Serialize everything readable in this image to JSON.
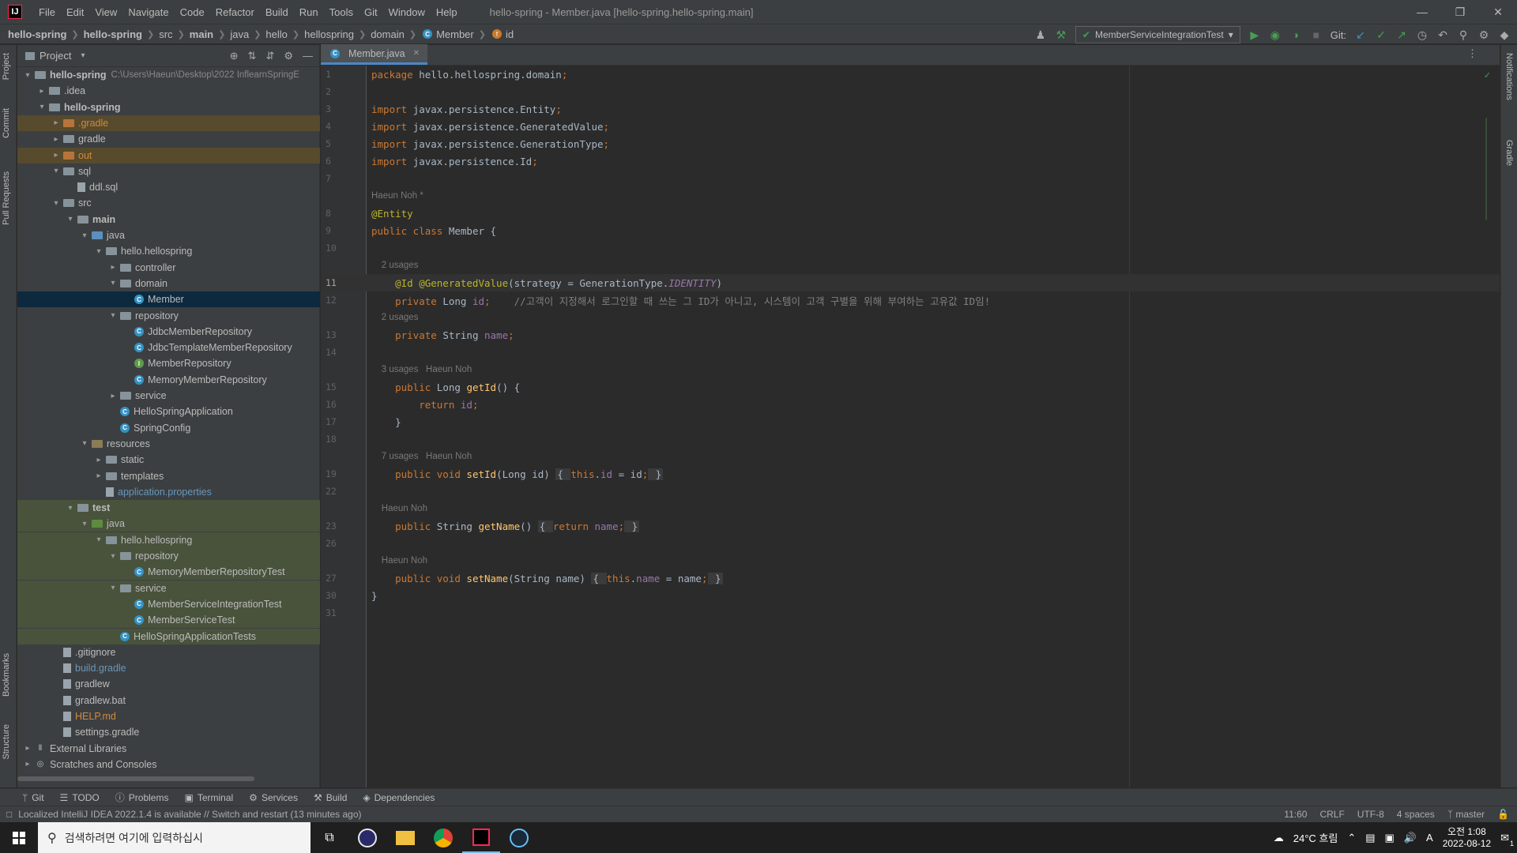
{
  "titlebar": {
    "menu": [
      "File",
      "Edit",
      "View",
      "Navigate",
      "Code",
      "Refactor",
      "Build",
      "Run",
      "Tools",
      "Git",
      "Window",
      "Help"
    ],
    "window_title": "hello-spring - Member.java [hello-spring.hello-spring.main]"
  },
  "navbar": {
    "crumbs": [
      "hello-spring",
      "hello-spring",
      "src",
      "main",
      "java",
      "hello",
      "hellospring",
      "domain",
      "Member",
      "id"
    ],
    "run_config": "MemberServiceIntegrationTest",
    "git_label": "Git:"
  },
  "stripes": {
    "left": [
      "Project",
      "Commit",
      "Pull Requests",
      "Bookmarks",
      "Structure"
    ],
    "right": [
      "Notifications",
      "Gradle"
    ]
  },
  "project": {
    "title": "Project",
    "root_path": "C:\\Users\\Haeun\\Desktop\\2022 InflearnSpringE",
    "tree": [
      {
        "label": "hello-spring",
        "depth": 0,
        "icon": "folder",
        "open": true,
        "bold": true
      },
      {
        "label": ".idea",
        "depth": 1,
        "icon": "folder",
        "open": false
      },
      {
        "label": "hello-spring",
        "depth": 1,
        "icon": "folder",
        "open": true,
        "bold": true
      },
      {
        "label": ".gradle",
        "depth": 2,
        "icon": "folder-excl",
        "open": false,
        "excl": true
      },
      {
        "label": "gradle",
        "depth": 2,
        "icon": "folder",
        "open": false
      },
      {
        "label": "out",
        "depth": 2,
        "icon": "folder-excl",
        "open": false,
        "excl": true
      },
      {
        "label": "sql",
        "depth": 2,
        "icon": "folder",
        "open": true
      },
      {
        "label": "ddl.sql",
        "depth": 3,
        "icon": "file"
      },
      {
        "label": "src",
        "depth": 2,
        "icon": "folder",
        "open": true
      },
      {
        "label": "main",
        "depth": 3,
        "icon": "folder",
        "open": true,
        "bold": true
      },
      {
        "label": "java",
        "depth": 4,
        "icon": "folder-src",
        "open": true
      },
      {
        "label": "hello.hellospring",
        "depth": 5,
        "icon": "folder",
        "open": true
      },
      {
        "label": "controller",
        "depth": 6,
        "icon": "folder",
        "open": false
      },
      {
        "label": "domain",
        "depth": 6,
        "icon": "folder",
        "open": true
      },
      {
        "label": "Member",
        "depth": 7,
        "icon": "class",
        "selected": true
      },
      {
        "label": "repository",
        "depth": 6,
        "icon": "folder",
        "open": true
      },
      {
        "label": "JdbcMemberRepository",
        "depth": 7,
        "icon": "class"
      },
      {
        "label": "JdbcTemplateMemberRepository",
        "depth": 7,
        "icon": "class"
      },
      {
        "label": "MemberRepository",
        "depth": 7,
        "icon": "interface"
      },
      {
        "label": "MemoryMemberRepository",
        "depth": 7,
        "icon": "class"
      },
      {
        "label": "service",
        "depth": 6,
        "icon": "folder",
        "open": false
      },
      {
        "label": "HelloSpringApplication",
        "depth": 6,
        "icon": "class"
      },
      {
        "label": "SpringConfig",
        "depth": 6,
        "icon": "class"
      },
      {
        "label": "resources",
        "depth": 4,
        "icon": "folder-res",
        "open": true
      },
      {
        "label": "static",
        "depth": 5,
        "icon": "folder",
        "open": false
      },
      {
        "label": "templates",
        "depth": 5,
        "icon": "folder",
        "open": false
      },
      {
        "label": "application.properties",
        "depth": 5,
        "icon": "file",
        "blue": true
      },
      {
        "label": "test",
        "depth": 3,
        "icon": "folder",
        "open": true,
        "bold": true,
        "test": true
      },
      {
        "label": "java",
        "depth": 4,
        "icon": "folder-test",
        "open": true,
        "test": true
      },
      {
        "label": "hello.hellospring",
        "depth": 5,
        "icon": "folder",
        "open": true,
        "test": true
      },
      {
        "label": "repository",
        "depth": 6,
        "icon": "folder",
        "open": true,
        "test": true
      },
      {
        "label": "MemoryMemberRepositoryTest",
        "depth": 7,
        "icon": "class",
        "test": true
      },
      {
        "label": "service",
        "depth": 6,
        "icon": "folder",
        "open": true,
        "test": true
      },
      {
        "label": "MemberServiceIntegrationTest",
        "depth": 7,
        "icon": "class",
        "test": true
      },
      {
        "label": "MemberServiceTest",
        "depth": 7,
        "icon": "class",
        "test": true
      },
      {
        "label": "HelloSpringApplicationTests",
        "depth": 6,
        "icon": "class",
        "test": true
      },
      {
        "label": ".gitignore",
        "depth": 2,
        "icon": "file"
      },
      {
        "label": "build.gradle",
        "depth": 2,
        "icon": "file",
        "blue": true
      },
      {
        "label": "gradlew",
        "depth": 2,
        "icon": "file"
      },
      {
        "label": "gradlew.bat",
        "depth": 2,
        "icon": "file"
      },
      {
        "label": "HELP.md",
        "depth": 2,
        "icon": "file",
        "orange": true
      },
      {
        "label": "settings.gradle",
        "depth": 2,
        "icon": "file"
      },
      {
        "label": "External Libraries",
        "depth": 0,
        "icon": "lib",
        "open": false
      },
      {
        "label": "Scratches and Consoles",
        "depth": 0,
        "icon": "scratch",
        "open": false
      }
    ]
  },
  "editor": {
    "tab": "Member.java",
    "lines": [
      {
        "n": "1",
        "code": [
          [
            "kw",
            "package "
          ],
          [
            "",
            "hello.hellospring.domain"
          ],
          [
            "kw",
            ";"
          ]
        ]
      },
      {
        "n": "2",
        "code": []
      },
      {
        "n": "3",
        "code": [
          [
            "kw",
            "import "
          ],
          [
            "",
            "javax.persistence."
          ],
          [
            "",
            "Entity"
          ],
          [
            "kw",
            ";"
          ]
        ]
      },
      {
        "n": "4",
        "code": [
          [
            "kw",
            "import "
          ],
          [
            "",
            "javax.persistence."
          ],
          [
            "",
            "GeneratedValue"
          ],
          [
            "kw",
            ";"
          ]
        ]
      },
      {
        "n": "5",
        "code": [
          [
            "kw",
            "import "
          ],
          [
            "",
            "javax.persistence."
          ],
          [
            "",
            "GenerationType"
          ],
          [
            "kw",
            ";"
          ]
        ]
      },
      {
        "n": "6",
        "code": [
          [
            "kw",
            "import "
          ],
          [
            "",
            "javax.persistence."
          ],
          [
            "",
            "Id"
          ],
          [
            "kw",
            ";"
          ]
        ]
      },
      {
        "n": "7",
        "code": []
      },
      {
        "n": "",
        "hint": "Haeun Noh *"
      },
      {
        "n": "8",
        "code": [
          [
            "ann",
            "@Entity"
          ]
        ]
      },
      {
        "n": "9",
        "code": [
          [
            "kw",
            "public class "
          ],
          [
            "",
            "Member {"
          ]
        ]
      },
      {
        "n": "10",
        "code": []
      },
      {
        "n": "",
        "hint": "    2 usages"
      },
      {
        "n": "11",
        "cur": true,
        "code": [
          [
            "ann",
            "    @Id @GeneratedValue"
          ],
          [
            "",
            "(strategy = GenerationType."
          ],
          [
            "ital",
            "IDENTITY"
          ],
          [
            "",
            ")"
          ]
        ]
      },
      {
        "n": "12",
        "code": [
          [
            "kw",
            "    private "
          ],
          [
            "",
            "Long "
          ],
          [
            "fld",
            "id"
          ],
          [
            "kw",
            ";"
          ],
          [
            "cmt",
            "    //고객이 지정해서 로그인할 때 쓰는 그 ID가 아니고, 시스템이 고객 구별을 위해 부여하는 고유값 ID임!"
          ]
        ]
      },
      {
        "n": "",
        "hint": "    2 usages"
      },
      {
        "n": "13",
        "code": [
          [
            "kw",
            "    private "
          ],
          [
            "",
            "String "
          ],
          [
            "fld",
            "name"
          ],
          [
            "kw",
            ";"
          ]
        ]
      },
      {
        "n": "14",
        "code": []
      },
      {
        "n": "",
        "hint": "    3 usages   Haeun Noh"
      },
      {
        "n": "15",
        "code": [
          [
            "kw",
            "    public "
          ],
          [
            "",
            "Long "
          ],
          [
            "fn",
            "getId"
          ],
          [
            "",
            "() {"
          ]
        ]
      },
      {
        "n": "16",
        "code": [
          [
            "kw",
            "        return "
          ],
          [
            "fld",
            "id"
          ],
          [
            "kw",
            ";"
          ]
        ]
      },
      {
        "n": "17",
        "code": [
          [
            "",
            "    }"
          ]
        ]
      },
      {
        "n": "18",
        "code": []
      },
      {
        "n": "",
        "hint": "    7 usages   Haeun Noh"
      },
      {
        "n": "19",
        "code": [
          [
            "kw",
            "    public void "
          ],
          [
            "fn",
            "setId"
          ],
          [
            "",
            "(Long id) "
          ],
          [
            "fold",
            "{ "
          ],
          [
            "kw",
            "this"
          ],
          [
            "",
            ".",
            ""
          ],
          [
            "fld",
            "id"
          ],
          [
            "",
            " = id"
          ],
          [
            "kw",
            ";"
          ],
          [
            "fold",
            " }"
          ]
        ]
      },
      {
        "n": "22",
        "code": []
      },
      {
        "n": "",
        "hint": "    Haeun Noh"
      },
      {
        "n": "23",
        "code": [
          [
            "kw",
            "    public "
          ],
          [
            "",
            "String "
          ],
          [
            "fn",
            "getName"
          ],
          [
            "",
            "() "
          ],
          [
            "fold",
            "{ "
          ],
          [
            "kw",
            "return "
          ],
          [
            "fld",
            "name"
          ],
          [
            "kw",
            ";"
          ],
          [
            "fold",
            " }"
          ]
        ]
      },
      {
        "n": "26",
        "code": []
      },
      {
        "n": "",
        "hint": "    Haeun Noh"
      },
      {
        "n": "27",
        "code": [
          [
            "kw",
            "    public void "
          ],
          [
            "fn",
            "setName"
          ],
          [
            "",
            "(String name) "
          ],
          [
            "fold",
            "{ "
          ],
          [
            "kw",
            "this"
          ],
          [
            "",
            "."
          ],
          [
            "fld",
            "name"
          ],
          [
            "",
            " = name"
          ],
          [
            "kw",
            ";"
          ],
          [
            "fold",
            " }"
          ]
        ]
      },
      {
        "n": "30",
        "code": [
          [
            "",
            "}"
          ]
        ]
      },
      {
        "n": "31",
        "code": []
      }
    ]
  },
  "bottom_tools": [
    "Git",
    "TODO",
    "Problems",
    "Terminal",
    "Services",
    "Build",
    "Dependencies"
  ],
  "status": {
    "message": "Localized IntelliJ IDEA 2022.1.4 is available // Switch and restart (13 minutes ago)",
    "position": "11:60",
    "line_sep": "CRLF",
    "encoding": "UTF-8",
    "indent": "4 spaces",
    "branch": "master"
  },
  "taskbar": {
    "search_placeholder": "검색하려면 여기에 입력하십시",
    "weather": "24°C 흐림",
    "ime": "A",
    "time": "오전 1:08",
    "date": "2022-08-12",
    "notif_count": "1"
  }
}
